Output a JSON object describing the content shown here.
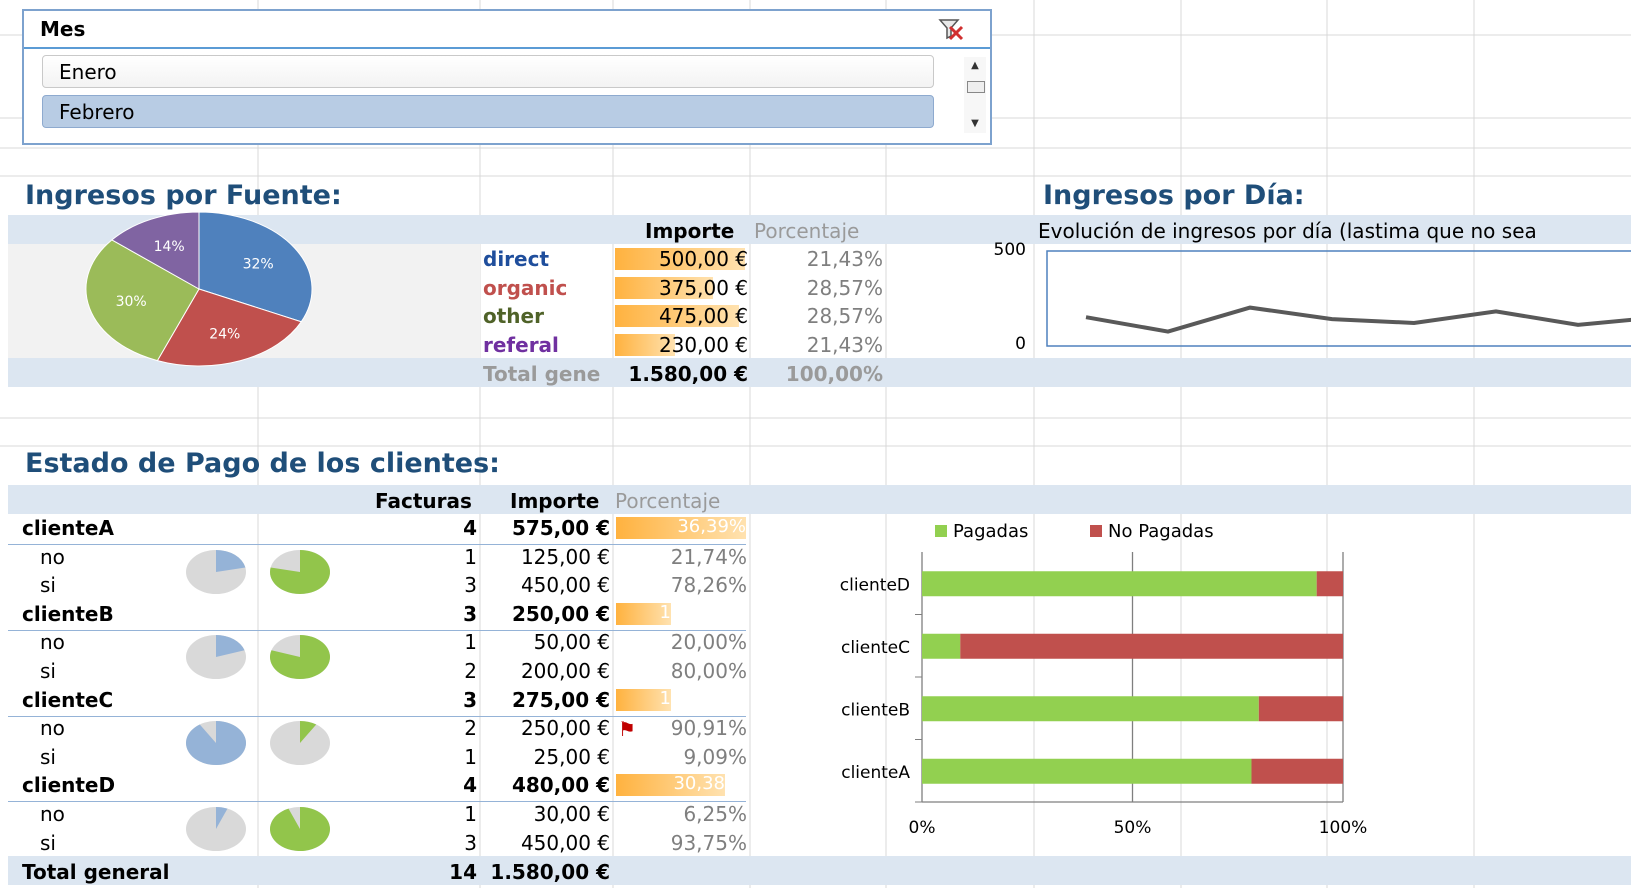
{
  "slicer": {
    "title": "Mes",
    "items": [
      "Enero",
      "Febrero"
    ],
    "selected": "Febrero"
  },
  "fuente": {
    "title": "Ingresos por Fuente:",
    "headers": {
      "importe": "Importe",
      "porcentaje": "Porcentaje"
    },
    "rows": [
      {
        "name": "direct",
        "importe": "500,00 €",
        "porcentaje": "21,43%",
        "color": "#1f4e9c"
      },
      {
        "name": "organic",
        "importe": "375,00 €",
        "porcentaje": "28,57%",
        "color": "#c0504d"
      },
      {
        "name": "other",
        "importe": "475,00 €",
        "porcentaje": "28,57%",
        "color": "#4f6228"
      },
      {
        "name": "referal",
        "importe": "230,00 €",
        "porcentaje": "21,43%",
        "color": "#7030a0"
      }
    ],
    "total": {
      "label": "Total gene",
      "importe": "1.580,00 €",
      "porcentaje": "100,00%"
    }
  },
  "pie": {
    "slices": [
      {
        "label": "32%",
        "value": 32,
        "color": "#4f81bd"
      },
      {
        "label": "24%",
        "value": 24,
        "color": "#c0504d"
      },
      {
        "label": "30%",
        "value": 30,
        "color": "#9bbb59"
      },
      {
        "label": "14%",
        "value": 14,
        "color": "#8064a2"
      }
    ]
  },
  "dia": {
    "title": "Ingresos por Día:",
    "chart_title": "Evolución de ingresos por día (lastima que no sea",
    "y_ticks": [
      "500",
      "0"
    ]
  },
  "pago": {
    "title": "Estado de Pago de los clientes:",
    "headers": {
      "facturas": "Facturas",
      "importe": "Importe",
      "porcentaje": "Porcentaje"
    },
    "clients": [
      {
        "name": "clienteA",
        "facturas": "4",
        "importe": "575,00 €",
        "porcentaje": "36,39%",
        "rows": [
          {
            "label": "no",
            "facturas": "1",
            "importe": "125,00 €",
            "porcentaje": "21,74%"
          },
          {
            "label": "si",
            "facturas": "3",
            "importe": "450,00 €",
            "porcentaje": "78,26%"
          }
        ]
      },
      {
        "name": "clienteB",
        "facturas": "3",
        "importe": "250,00 €",
        "porcentaje": "1",
        "rows": [
          {
            "label": "no",
            "facturas": "1",
            "importe": "50,00 €",
            "porcentaje": "20,00%"
          },
          {
            "label": "si",
            "facturas": "2",
            "importe": "200,00 €",
            "porcentaje": "80,00%"
          }
        ]
      },
      {
        "name": "clienteC",
        "facturas": "3",
        "importe": "275,00 €",
        "porcentaje": "1",
        "rows": [
          {
            "label": "no",
            "facturas": "2",
            "importe": "250,00 €",
            "porcentaje": "90,91%"
          },
          {
            "label": "si",
            "facturas": "1",
            "importe": "25,00 €",
            "porcentaje": "9,09%"
          }
        ]
      },
      {
        "name": "clienteD",
        "facturas": "4",
        "importe": "480,00 €",
        "porcentaje": "30,38",
        "rows": [
          {
            "label": "no",
            "facturas": "1",
            "importe": "30,00 €",
            "porcentaje": "6,25%"
          },
          {
            "label": "si",
            "facturas": "3",
            "importe": "450,00 €",
            "porcentaje": "93,75%"
          }
        ]
      }
    ],
    "total": {
      "label": "Total general",
      "facturas": "14",
      "importe": "1.580,00 €"
    }
  },
  "chart_data": [
    {
      "type": "pie",
      "categories": [
        "direct",
        "organic",
        "other",
        "referal"
      ],
      "values": [
        32,
        24,
        30,
        14
      ],
      "labels": [
        "32%",
        "24%",
        "30%",
        "14%"
      ]
    },
    {
      "type": "line",
      "title": "Evolución de ingresos por día (lastima que no sea",
      "ylim": [
        0,
        500
      ],
      "y_ticks": [
        0,
        500
      ],
      "values": [
        150,
        75,
        200,
        140,
        120,
        180,
        110,
        150
      ]
    },
    {
      "type": "bar",
      "orientation": "horizontal",
      "stacked": "percent",
      "categories": [
        "clienteD",
        "clienteC",
        "clienteB",
        "clienteA"
      ],
      "series": [
        {
          "name": "Pagadas",
          "values": [
            93.75,
            9.09,
            80.0,
            78.26
          ],
          "color": "#92d050"
        },
        {
          "name": "No Pagadas",
          "values": [
            6.25,
            90.91,
            20.0,
            21.74
          ],
          "color": "#c0504d"
        }
      ],
      "x_ticks": [
        "0%",
        "50%",
        "100%"
      ],
      "legend": "top",
      "grid": true
    }
  ]
}
